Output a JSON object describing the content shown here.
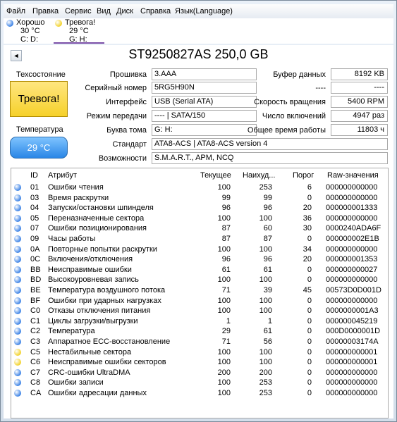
{
  "colors": {
    "good": "#3b82e6",
    "caution": "#f2d22a"
  },
  "menu": [
    "Файл",
    "Правка",
    "Сервис",
    "Вид",
    "Диск",
    "Справка",
    "Язык(Language)"
  ],
  "drives": [
    {
      "status": "Хорошо",
      "temp": "30 °C",
      "letter": "C: D:",
      "color": "#3b82e6"
    },
    {
      "status": "Тревога!",
      "temp": "29 °C",
      "letter": "G: H:",
      "color": "#f2d22a"
    }
  ],
  "header": {
    "prev_icon": "◄",
    "model": "ST9250827AS 250,0 GB"
  },
  "health": {
    "label": "Техсостояние",
    "status": "Тревога!",
    "temp_label": "Температура",
    "temp": "29 °C"
  },
  "info": {
    "firmware_label": "Прошивка",
    "firmware": "3.AAA",
    "serial_label": "Серийный номер",
    "serial": "5RG5H90N",
    "interface_label": "Интерфейс",
    "interface": "USB (Serial ATA)",
    "transfer_label": "Режим передачи",
    "transfer": "---- | SATA/150",
    "letter_label": "Буква тома",
    "letter": "G: H:",
    "standard_label": "Стандарт",
    "standard": "ATA8-ACS | ATA8-ACS version 4",
    "features_label": "Возможности",
    "features": "S.M.A.R.T., APM, NCQ",
    "buffer_label": "Буфер данных",
    "buffer": "8192 KB",
    "blank1_label": "----",
    "blank1": "----",
    "rpm_label": "Скорость вращения",
    "rpm": "5400 RPM",
    "power_count_label": "Число включений",
    "power_count": "4947 раз",
    "power_hours_label": "Общее время работы",
    "power_hours": "11803 ч"
  },
  "table": {
    "headers": {
      "id": "ID",
      "attr": "Атрибут",
      "current": "Текущее",
      "worst": "Наихуд...",
      "threshold": "Порог",
      "raw": "Raw-значения"
    },
    "rows": [
      {
        "id": "01",
        "name": "Ошибки чтения",
        "current": "100",
        "worst": "253",
        "threshold": "6",
        "raw": "000000000000",
        "status": "good"
      },
      {
        "id": "03",
        "name": "Время раскрутки",
        "current": "99",
        "worst": "99",
        "threshold": "0",
        "raw": "000000000000",
        "status": "good"
      },
      {
        "id": "04",
        "name": "Запуски/остановки шпинделя",
        "current": "96",
        "worst": "96",
        "threshold": "20",
        "raw": "000000001333",
        "status": "good"
      },
      {
        "id": "05",
        "name": "Переназначенные сектора",
        "current": "100",
        "worst": "100",
        "threshold": "36",
        "raw": "000000000000",
        "status": "good"
      },
      {
        "id": "07",
        "name": "Ошибки позиционирования",
        "current": "87",
        "worst": "60",
        "threshold": "30",
        "raw": "0000240ADA6F",
        "status": "good"
      },
      {
        "id": "09",
        "name": "Часы работы",
        "current": "87",
        "worst": "87",
        "threshold": "0",
        "raw": "000000002E1B",
        "status": "good"
      },
      {
        "id": "0A",
        "name": "Повторные попытки раскрутки",
        "current": "100",
        "worst": "100",
        "threshold": "34",
        "raw": "000000000000",
        "status": "good"
      },
      {
        "id": "0C",
        "name": "Включения/отключения",
        "current": "96",
        "worst": "96",
        "threshold": "20",
        "raw": "000000001353",
        "status": "good"
      },
      {
        "id": "BB",
        "name": "Неисправимые ошибки",
        "current": "61",
        "worst": "61",
        "threshold": "0",
        "raw": "000000000027",
        "status": "good"
      },
      {
        "id": "BD",
        "name": "Высокоуровневая запись",
        "current": "100",
        "worst": "100",
        "threshold": "0",
        "raw": "000000000000",
        "status": "good"
      },
      {
        "id": "BE",
        "name": "Температура воздушного потока",
        "current": "71",
        "worst": "39",
        "threshold": "45",
        "raw": "00573D0D001D",
        "status": "good"
      },
      {
        "id": "BF",
        "name": "Ошибки при ударных нагрузках",
        "current": "100",
        "worst": "100",
        "threshold": "0",
        "raw": "000000000000",
        "status": "good"
      },
      {
        "id": "C0",
        "name": "Отказы отключения питания",
        "current": "100",
        "worst": "100",
        "threshold": "0",
        "raw": "0000000001A3",
        "status": "good"
      },
      {
        "id": "C1",
        "name": "Циклы загрузки/выгрузки",
        "current": "1",
        "worst": "1",
        "threshold": "0",
        "raw": "000000045219",
        "status": "good"
      },
      {
        "id": "C2",
        "name": "Температура",
        "current": "29",
        "worst": "61",
        "threshold": "0",
        "raw": "000D0000001D",
        "status": "good"
      },
      {
        "id": "C3",
        "name": "Аппаратное ECC-восстановление",
        "current": "71",
        "worst": "56",
        "threshold": "0",
        "raw": "00000003174A",
        "status": "good"
      },
      {
        "id": "C5",
        "name": "Нестабильные сектора",
        "current": "100",
        "worst": "100",
        "threshold": "0",
        "raw": "000000000001",
        "status": "caution"
      },
      {
        "id": "C6",
        "name": "Неисправимые ошибки секторов",
        "current": "100",
        "worst": "100",
        "threshold": "0",
        "raw": "000000000001",
        "status": "caution"
      },
      {
        "id": "C7",
        "name": "CRC-ошибки UltraDMA",
        "current": "200",
        "worst": "200",
        "threshold": "0",
        "raw": "000000000000",
        "status": "good"
      },
      {
        "id": "C8",
        "name": "Ошибки записи",
        "current": "100",
        "worst": "253",
        "threshold": "0",
        "raw": "000000000000",
        "status": "good"
      },
      {
        "id": "CA",
        "name": "Ошибки адресации данных",
        "current": "100",
        "worst": "253",
        "threshold": "0",
        "raw": "000000000000",
        "status": "good"
      }
    ]
  }
}
